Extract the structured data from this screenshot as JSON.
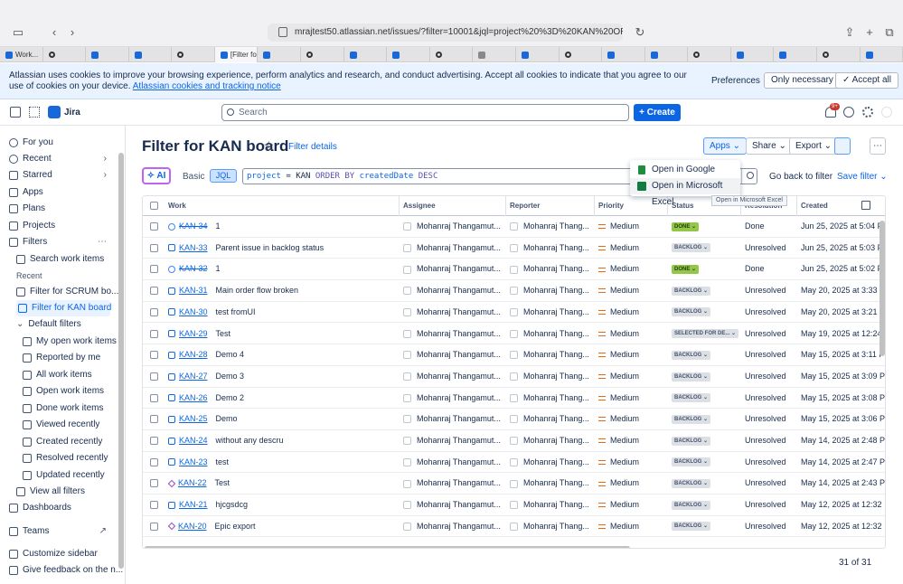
{
  "browser": {
    "url": "mrajtest50.atlassian.net/issues/?filter=10001&jql=project%20%3D%20KAN%20ORDER%20BY%20createdDate%20DESC",
    "tabs": [
      "Work...",
      "",
      "",
      "",
      "",
      "[Filter for K...",
      "",
      "",
      "",
      "",
      "",
      "",
      "",
      "",
      "",
      "",
      "",
      "",
      "",
      "",
      ""
    ]
  },
  "cookie": {
    "message": "Atlassian uses cookies to improve your browsing experience, perform analytics and research, and conduct advertising. Accept all cookies to indicate that you agree to our use of cookies on your device.",
    "link": "Atlassian cookies and tracking notice",
    "preferences": "Preferences",
    "only_necessary": "Only necessary",
    "accept_all": "Accept all"
  },
  "topnav": {
    "product": "Jira",
    "search_placeholder": "Search",
    "create": "Create",
    "notif_count": "9+"
  },
  "sidebar": {
    "items": [
      {
        "label": "For you"
      },
      {
        "label": "Recent"
      },
      {
        "label": "Starred"
      },
      {
        "label": "Apps"
      },
      {
        "label": "Plans"
      },
      {
        "label": "Projects"
      },
      {
        "label": "Filters"
      },
      {
        "label": "Search work items"
      },
      {
        "label": "Recent"
      },
      {
        "label": "Filter for SCRUM bo..."
      },
      {
        "label": "Filter for KAN board"
      },
      {
        "label": "Default filters"
      },
      {
        "label": "My open work items"
      },
      {
        "label": "Reported by me"
      },
      {
        "label": "All work items"
      },
      {
        "label": "Open work items"
      },
      {
        "label": "Done work items"
      },
      {
        "label": "Viewed recently"
      },
      {
        "label": "Created recently"
      },
      {
        "label": "Resolved recently"
      },
      {
        "label": "Updated recently"
      },
      {
        "label": "View all filters"
      },
      {
        "label": "Dashboards"
      },
      {
        "label": "Teams"
      },
      {
        "label": "Customize sidebar"
      },
      {
        "label": "Give feedback on the n..."
      }
    ]
  },
  "main": {
    "title": "Filter for KAN board",
    "filter_details": "Filter details",
    "apps": "Apps",
    "share": "Share",
    "export": "Export",
    "ai": "AI",
    "basic": "Basic",
    "jql": "JQL",
    "query": {
      "p1": "project",
      "p2": " = KAN ",
      "p3": "ORDER BY",
      "p4": " createdDate ",
      "p5": "DESC"
    },
    "go_back": "Go back to filter",
    "save_filter": "Save filter",
    "dropdown": [
      "Open in Google Sheets",
      "Open in Microsoft Excel"
    ],
    "tooltip": "Open in Microsoft Excel",
    "count": "31 of 31"
  },
  "table": {
    "headers": [
      "Work",
      "Assignee",
      "Reporter",
      "Priority",
      "Status",
      "Resolution",
      "Created"
    ],
    "rows": [
      {
        "type": "sub",
        "key": "KAN-34",
        "done": true,
        "summary": "1",
        "assignee": "Mohanraj Thangamut...",
        "reporter": "Mohanraj Thang...",
        "priority": "Medium",
        "status": "DONE",
        "status_kind": "done",
        "resolution": "Done",
        "created": "Jun 25, 2025 at 5:04 P"
      },
      {
        "type": "task",
        "key": "KAN-33",
        "done": false,
        "summary": "Parent issue in backlog status",
        "assignee": "Mohanraj Thangamut...",
        "reporter": "Mohanraj Thang...",
        "priority": "Medium",
        "status": "BACKLOG",
        "status_kind": "backlog",
        "resolution": "Unresolved",
        "created": "Jun 25, 2025 at 5:03 P"
      },
      {
        "type": "sub",
        "key": "KAN-32",
        "done": true,
        "summary": "1",
        "assignee": "Mohanraj Thangamut...",
        "reporter": "Mohanraj Thang...",
        "priority": "Medium",
        "status": "DONE",
        "status_kind": "done",
        "resolution": "Done",
        "created": "Jun 25, 2025 at 5:02 P"
      },
      {
        "type": "task",
        "key": "KAN-31",
        "done": false,
        "summary": "Main order flow broken",
        "assignee": "Mohanraj Thangamut...",
        "reporter": "Mohanraj Thang...",
        "priority": "Medium",
        "status": "BACKLOG",
        "status_kind": "backlog",
        "resolution": "Unresolved",
        "created": "May 20, 2025 at 3:33 P"
      },
      {
        "type": "task",
        "key": "KAN-30",
        "done": false,
        "summary": "test fromUI",
        "assignee": "Mohanraj Thangamut...",
        "reporter": "Mohanraj Thang...",
        "priority": "Medium",
        "status": "BACKLOG",
        "status_kind": "backlog",
        "resolution": "Unresolved",
        "created": "May 20, 2025 at 3:21 P"
      },
      {
        "type": "task",
        "key": "KAN-29",
        "done": false,
        "summary": "Test",
        "assignee": "Mohanraj Thangamut...",
        "reporter": "Mohanraj Thang...",
        "priority": "Medium",
        "status": "SELECTED FOR DE...",
        "status_kind": "sel",
        "resolution": "Unresolved",
        "created": "May 19, 2025 at 12:24"
      },
      {
        "type": "task",
        "key": "KAN-28",
        "done": false,
        "summary": "Demo 4",
        "assignee": "Mohanraj Thangamut...",
        "reporter": "Mohanraj Thang...",
        "priority": "Medium",
        "status": "BACKLOG",
        "status_kind": "backlog",
        "resolution": "Unresolved",
        "created": "May 15, 2025 at 3:11 P"
      },
      {
        "type": "task",
        "key": "KAN-27",
        "done": false,
        "summary": "Demo 3",
        "assignee": "Mohanraj Thangamut...",
        "reporter": "Mohanraj Thang...",
        "priority": "Medium",
        "status": "BACKLOG",
        "status_kind": "backlog",
        "resolution": "Unresolved",
        "created": "May 15, 2025 at 3:09 P"
      },
      {
        "type": "task",
        "key": "KAN-26",
        "done": false,
        "summary": "Demo 2",
        "assignee": "Mohanraj Thangamut...",
        "reporter": "Mohanraj Thang...",
        "priority": "Medium",
        "status": "BACKLOG",
        "status_kind": "backlog",
        "resolution": "Unresolved",
        "created": "May 15, 2025 at 3:08 P"
      },
      {
        "type": "task",
        "key": "KAN-25",
        "done": false,
        "summary": "Demo",
        "assignee": "Mohanraj Thangamut...",
        "reporter": "Mohanraj Thang...",
        "priority": "Medium",
        "status": "BACKLOG",
        "status_kind": "backlog",
        "resolution": "Unresolved",
        "created": "May 15, 2025 at 3:06 P"
      },
      {
        "type": "task",
        "key": "KAN-24",
        "done": false,
        "summary": "without any descru",
        "assignee": "Mohanraj Thangamut...",
        "reporter": "Mohanraj Thang...",
        "priority": "Medium",
        "status": "BACKLOG",
        "status_kind": "backlog",
        "resolution": "Unresolved",
        "created": "May 14, 2025 at 2:48 P"
      },
      {
        "type": "task",
        "key": "KAN-23",
        "done": false,
        "summary": "test",
        "assignee": "Mohanraj Thangamut...",
        "reporter": "Mohanraj Thang...",
        "priority": "Medium",
        "status": "BACKLOG",
        "status_kind": "backlog",
        "resolution": "Unresolved",
        "created": "May 14, 2025 at 2:47 P"
      },
      {
        "type": "epic",
        "key": "KAN-22",
        "done": false,
        "summary": "Test",
        "assignee": "Mohanraj Thangamut...",
        "reporter": "Mohanraj Thang...",
        "priority": "Medium",
        "status": "BACKLOG",
        "status_kind": "backlog",
        "resolution": "Unresolved",
        "created": "May 14, 2025 at 2:43 P"
      },
      {
        "type": "task",
        "key": "KAN-21",
        "done": false,
        "summary": "hjcgsdcg",
        "assignee": "Mohanraj Thangamut...",
        "reporter": "Mohanraj Thang...",
        "priority": "Medium",
        "status": "BACKLOG",
        "status_kind": "backlog",
        "resolution": "Unresolved",
        "created": "May 12, 2025 at 12:32"
      },
      {
        "type": "epic",
        "key": "KAN-20",
        "done": false,
        "summary": "Epic export",
        "assignee": "Mohanraj Thangamut...",
        "reporter": "Mohanraj Thang...",
        "priority": "Medium",
        "status": "BACKLOG",
        "status_kind": "backlog",
        "resolution": "Unresolved",
        "created": "May 12, 2025 at 12:32"
      }
    ]
  }
}
